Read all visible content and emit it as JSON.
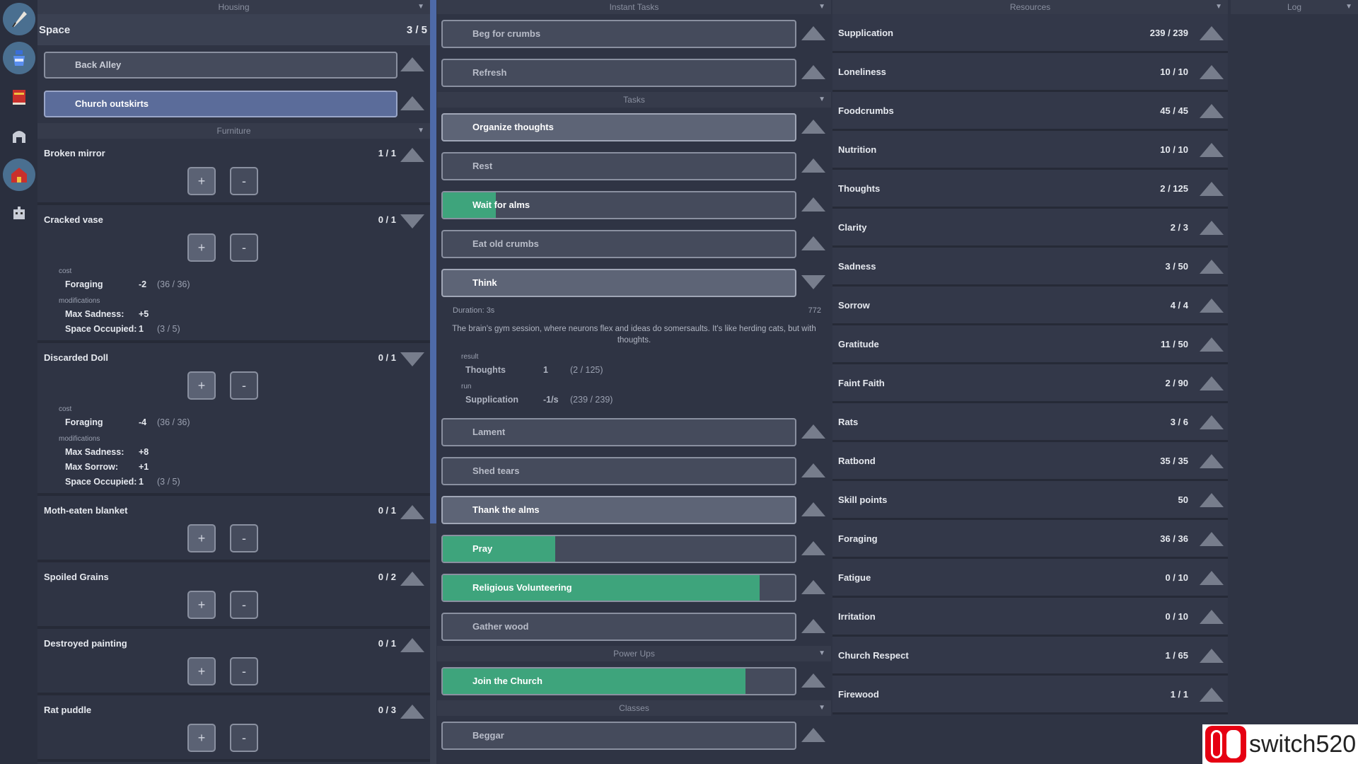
{
  "sidebar": {
    "icons": [
      "quill-icon",
      "potion-icon",
      "book-icon",
      "helmet-icon",
      "house-icon",
      "robot-icon"
    ]
  },
  "housing": {
    "title": "Housing",
    "space_label": "Space",
    "space_value": "3 / 5",
    "options": [
      {
        "label": "Back Alley",
        "selected": false
      },
      {
        "label": "Church outskirts",
        "selected": true
      }
    ],
    "furniture_title": "Furniture",
    "furniture": [
      {
        "name": "Broken mirror",
        "count": "1 / 1",
        "expanded": false
      },
      {
        "name": "Cracked vase",
        "count": "0 / 1",
        "expanded": true,
        "cost_label": "cost",
        "cost": [
          {
            "k": "Foraging",
            "v": "-2",
            "extra": "(36 / 36)"
          }
        ],
        "mod_label": "modifications",
        "mods": [
          {
            "k": "Max Sadness:",
            "v": "+5",
            "extra": ""
          },
          {
            "k": "Space Occupied:",
            "v": "1",
            "extra": "(3 / 5)"
          }
        ]
      },
      {
        "name": "Discarded Doll",
        "count": "0 / 1",
        "expanded": true,
        "cost_label": "cost",
        "cost": [
          {
            "k": "Foraging",
            "v": "-4",
            "extra": "(36 / 36)"
          }
        ],
        "mod_label": "modifications",
        "mods": [
          {
            "k": "Max Sadness:",
            "v": "+8",
            "extra": ""
          },
          {
            "k": "Max Sorrow:",
            "v": "+1",
            "extra": ""
          },
          {
            "k": "Space Occupied:",
            "v": "1",
            "extra": "(3 / 5)"
          }
        ]
      },
      {
        "name": "Moth-eaten blanket",
        "count": "0 / 1",
        "expanded": false
      },
      {
        "name": "Spoiled Grains",
        "count": "0 / 2",
        "expanded": false
      },
      {
        "name": "Destroyed painting",
        "count": "0 / 1",
        "expanded": false
      },
      {
        "name": "Rat puddle",
        "count": "0 / 3",
        "expanded": false
      }
    ],
    "plus": "+",
    "minus": "-"
  },
  "tasks": {
    "instant_title": "Instant Tasks",
    "instant": [
      {
        "label": "Beg for crumbs",
        "progress": 0,
        "lit": false
      },
      {
        "label": "Refresh",
        "progress": 0,
        "lit": false
      }
    ],
    "tasks_title": "Tasks",
    "tasks": [
      {
        "label": "Organize thoughts",
        "progress": 0,
        "lit": true
      },
      {
        "label": "Rest",
        "progress": 0,
        "lit": false
      },
      {
        "label": "Wait for alms",
        "progress": 0.15,
        "lit": false
      },
      {
        "label": "Eat old crumbs",
        "progress": 0,
        "lit": false
      },
      {
        "label": "Think",
        "progress": 0,
        "lit": true,
        "expanded": true
      },
      {
        "label": "Lament",
        "progress": 0,
        "lit": false
      },
      {
        "label": "Shed tears",
        "progress": 0,
        "lit": false
      },
      {
        "label": "Thank the alms",
        "progress": 0,
        "lit": true
      },
      {
        "label": "Pray",
        "progress": 0.32,
        "lit": false
      },
      {
        "label": "Religious Volunteering",
        "progress": 0.9,
        "lit": false
      },
      {
        "label": "Gather wood",
        "progress": 0,
        "lit": false
      }
    ],
    "think_detail": {
      "duration": "Duration: 3s",
      "number": "772",
      "desc": "The brain's gym session, where neurons flex and ideas do somersaults. It's like herding cats, but with thoughts.",
      "result_label": "result",
      "result": {
        "k": "Thoughts",
        "v": "1",
        "extra": "(2 / 125)"
      },
      "run_label": "run",
      "run": {
        "k": "Supplication",
        "v": "-1/s",
        "extra": "(239 / 239)"
      }
    },
    "powerups_title": "Power Ups",
    "powerups": [
      {
        "label": "Join the Church",
        "progress": 0.86,
        "lit": false
      }
    ],
    "classes_title": "Classes",
    "classes": [
      {
        "label": "Beggar",
        "progress": 0,
        "lit": false
      }
    ]
  },
  "resources": {
    "title": "Resources",
    "items": [
      {
        "name": "Supplication",
        "value": "239 / 239"
      },
      {
        "name": "Loneliness",
        "value": "10 / 10"
      },
      {
        "name": "Foodcrumbs",
        "value": "45 / 45"
      },
      {
        "name": "Nutrition",
        "value": "10 / 10"
      },
      {
        "name": "Thoughts",
        "value": "2 / 125"
      },
      {
        "name": "Clarity",
        "value": "2 / 3"
      },
      {
        "name": "Sadness",
        "value": "3 / 50"
      },
      {
        "name": "Sorrow",
        "value": "4 / 4"
      },
      {
        "name": "Gratitude",
        "value": "11 / 50"
      },
      {
        "name": "Faint Faith",
        "value": "2 / 90"
      },
      {
        "name": "Rats",
        "value": "3 / 6"
      },
      {
        "name": "Ratbond",
        "value": "35 / 35"
      },
      {
        "name": "Skill points",
        "value": "50"
      },
      {
        "name": "Foraging",
        "value": "36 / 36"
      },
      {
        "name": "Fatigue",
        "value": "0 / 10"
      },
      {
        "name": "Irritation",
        "value": "0 / 10"
      },
      {
        "name": "Church Respect",
        "value": "1 / 65"
      },
      {
        "name": "Firewood",
        "value": "1 / 1"
      }
    ]
  },
  "log": {
    "title": "Log"
  },
  "watermark": {
    "text": "switch520"
  },
  "colors": {
    "accent": "#3ea47c",
    "selected": "#5b6c9a",
    "background": "#2f3444"
  }
}
